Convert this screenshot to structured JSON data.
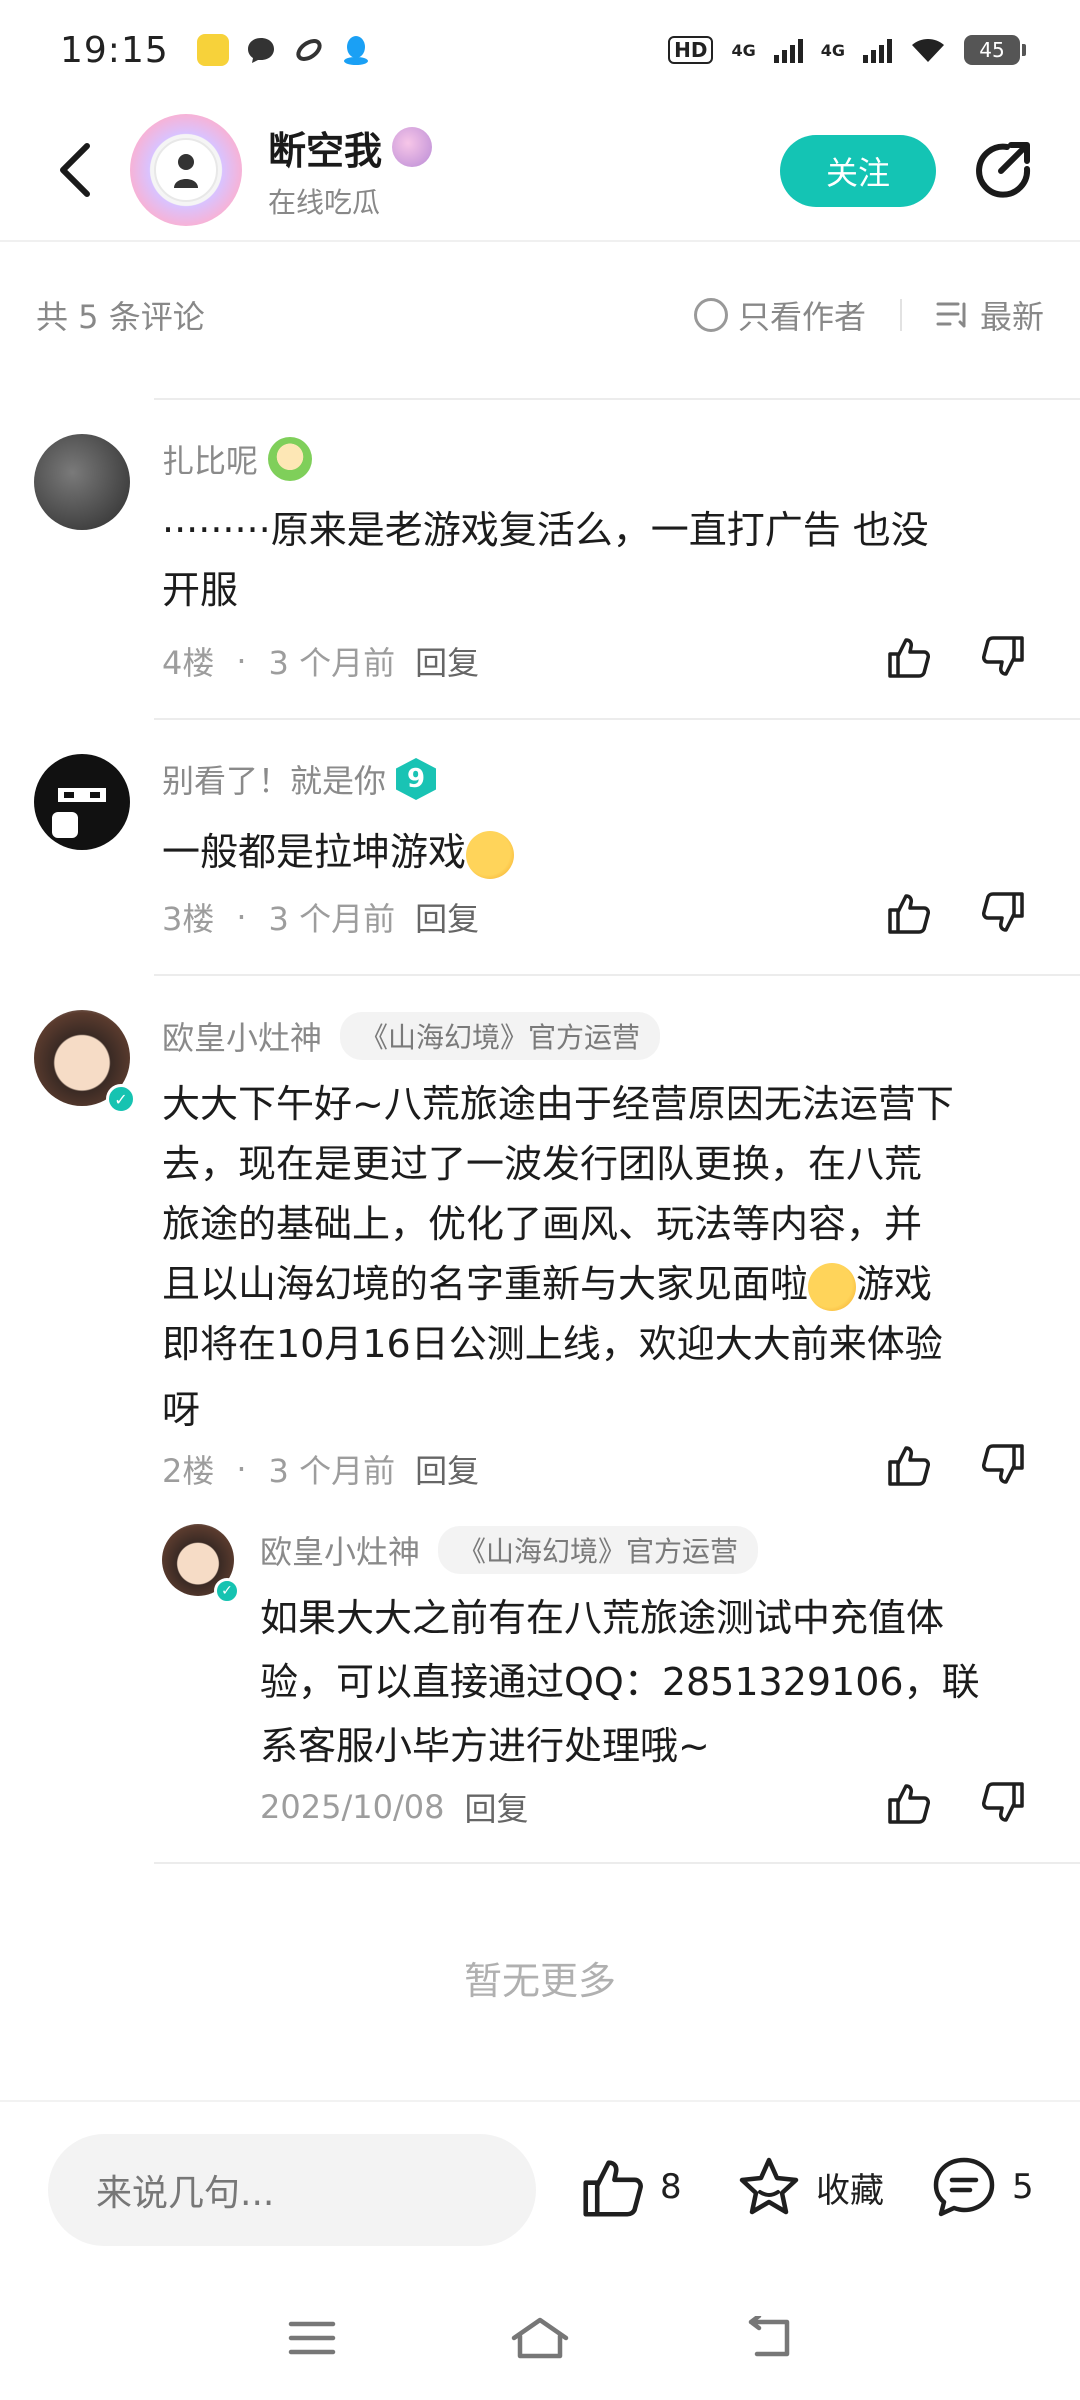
{
  "status_bar": {
    "time": "19:15",
    "hd_label": "HD",
    "network_1": "4G",
    "network_2": "4G",
    "battery": "45"
  },
  "header": {
    "username": "断空我",
    "user_status": "在线吃瓜",
    "follow_label": "关注"
  },
  "filter": {
    "count_label": "共 5 条评论",
    "author_only_label": "只看作者",
    "sort_label": "最新"
  },
  "comments": [
    {
      "name": "扎比呢",
      "text_line1": "·········原来是老游戏复活么，一直打广告 也没",
      "text_line2": "开服",
      "floor": "4楼",
      "time": "3 个月前",
      "reply": "回复"
    },
    {
      "name": "别看了！就是你",
      "level": "9",
      "text": "一般都是拉坤游戏",
      "floor": "3楼",
      "time": "3 个月前",
      "reply": "回复"
    },
    {
      "name": "欧皇小灶神",
      "tag": "《山海幻境》官方运营",
      "lines": [
        "大大下午好~八荒旅途由于经营原因无法运营下",
        "去，现在是更过了一波发行团队更换，在八荒",
        "旅途的基础上，优化了画风、玩法等内容，并",
        "且以山海幻境的名字重新与大家见面啦",
        "即将在10月16日公测上线，欢迎大大前来体验",
        "呀"
      ],
      "line4_suffix": "游戏",
      "floor": "2楼",
      "time": "3 个月前",
      "reply": "回复"
    }
  ],
  "sub_reply": {
    "name": "欧皇小灶神",
    "tag": "《山海幻境》官方运营",
    "lines": [
      "如果大大之前有在八荒旅途测试中充值体",
      "验，可以直接通过QQ：2851329106，联",
      "系客服小毕方进行处理哦~"
    ],
    "date": "2025/10/08",
    "reply": "回复"
  },
  "no_more_label": "暂无更多",
  "bottom_bar": {
    "input_placeholder": "来说几句...",
    "like_count": "8",
    "favorite_label": "收藏",
    "comment_count": "5"
  },
  "colors": {
    "accent": "#14c4b4",
    "text_primary": "#1c1c1c",
    "text_secondary": "#8a8a8a"
  }
}
